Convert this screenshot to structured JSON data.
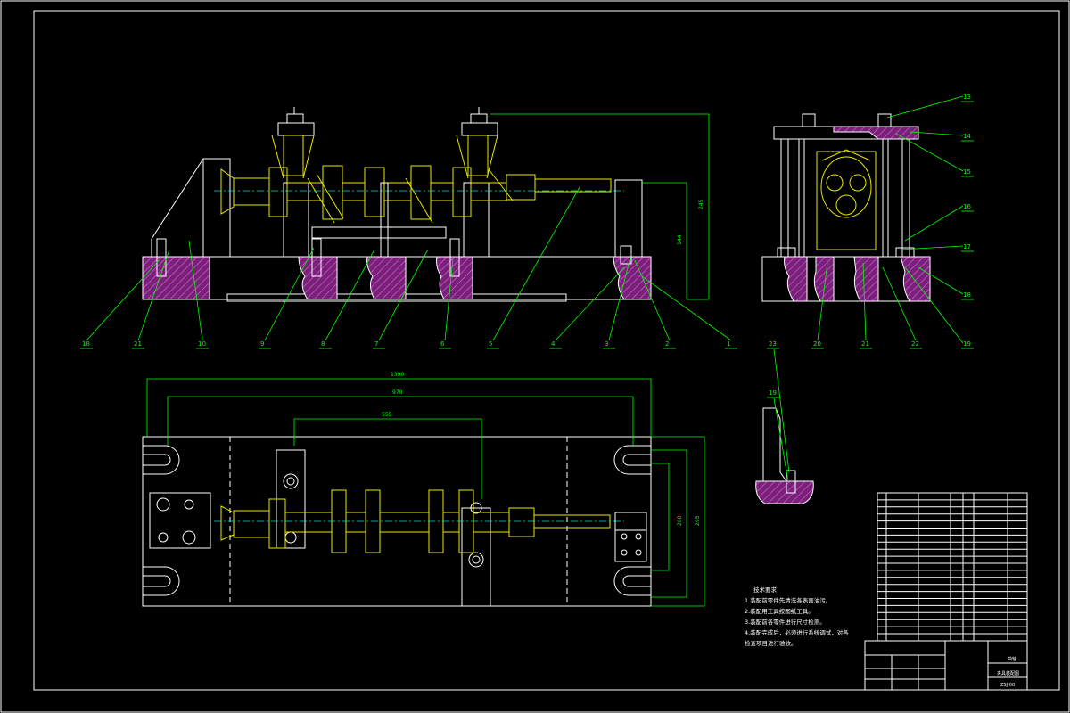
{
  "balloons_front": [
    "18",
    "21",
    "10",
    "9",
    "8",
    "7",
    "6",
    "5",
    "4",
    "3",
    "2",
    "1"
  ],
  "balloons_side_top": [
    "13",
    "14",
    "15",
    "16",
    "17",
    "18",
    "19"
  ],
  "balloons_side_bottom": [
    "20",
    "21",
    "22"
  ],
  "balloons_detail": [
    "23",
    "19"
  ],
  "dimensions": {
    "front_height_total": "245",
    "front_height_inner": "144",
    "top_overall": "1390",
    "top_inner": "970",
    "top_center": "555",
    "top_right_1": "260",
    "top_right_2": "295"
  },
  "technical_requirements": {
    "title": "技术要求",
    "lines": [
      "1.装配前零件先清洗各表面油污。",
      "2.装配用工具按图纸工具。",
      "3.装配前各零件进行尺寸检测。",
      "4.装配完成后，必须进行系统调试，对各",
      "检查项目进行验收。"
    ]
  },
  "title_block": {
    "drawing_name": "夹具装配图",
    "drawing_code": "ZSJ-00",
    "unit": "曲轴"
  },
  "colors": {
    "background": "#000000",
    "outline": "#ffffff",
    "part": "#e8e800",
    "dimension": "#00ff00",
    "centerline": "#00dcdc",
    "hatch": "#c040c0"
  }
}
